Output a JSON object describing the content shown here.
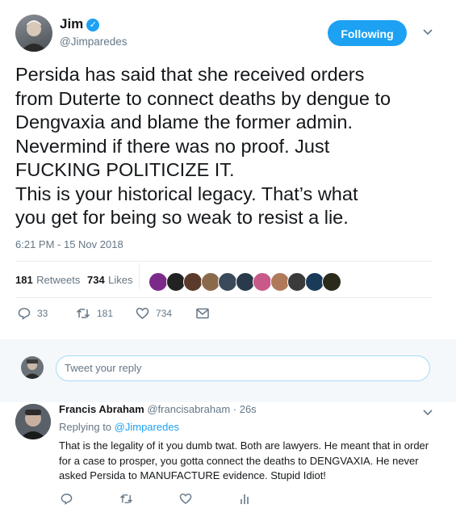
{
  "tweet": {
    "author_name": "Jim",
    "author_handle": "@Jimparedes",
    "follow_label": "Following",
    "text": "Persida has said that she received orders\nfrom Duterte to connect deaths by dengue to\nDengvaxia and blame the former admin.\nNevermind if there was no proof. Just\nFUCKING POLITICIZE IT.\nThis is your historical  legacy. That’s what\nyou get for being so weak to resist a lie.",
    "timestamp": "6:21 PM - 15 Nov 2018",
    "retweets_count": "181",
    "retweets_label": "Retweets",
    "likes_count": "734",
    "likes_label": "Likes",
    "actions": {
      "replies": "33",
      "retweets": "181",
      "likes": "734"
    },
    "liker_avatars": [
      "#7b2a8a",
      "#222222",
      "#5a3a2a",
      "#8a6a4a",
      "#3a4a5a",
      "#2a3a4a",
      "#c85a8a",
      "#b07a5a",
      "#3a3a3a",
      "#1a3a5a",
      "#2a2a1a"
    ]
  },
  "reply_box": {
    "placeholder": "Tweet your reply"
  },
  "reply": {
    "author_name": "Francis Abraham",
    "author_handle": "@francisabraham",
    "time": "· 26s",
    "replying_prefix": "Replying to ",
    "replying_to": "@Jimparedes",
    "text": "That is the legality of it you dumb twat. Both are lawyers. He meant that in order for a case to prosper, you gotta connect the deaths to DENGVAXIA. He never asked Persida to MANUFACTURE evidence. Stupid Idiot!"
  },
  "colors": {
    "accent": "#1da1f2",
    "muted": "#657786",
    "text": "#14171a"
  },
  "icons": [
    "verified-badge-icon",
    "chevron-down-icon",
    "reply-icon",
    "retweet-icon",
    "heart-icon",
    "message-icon",
    "stats-icon"
  ]
}
